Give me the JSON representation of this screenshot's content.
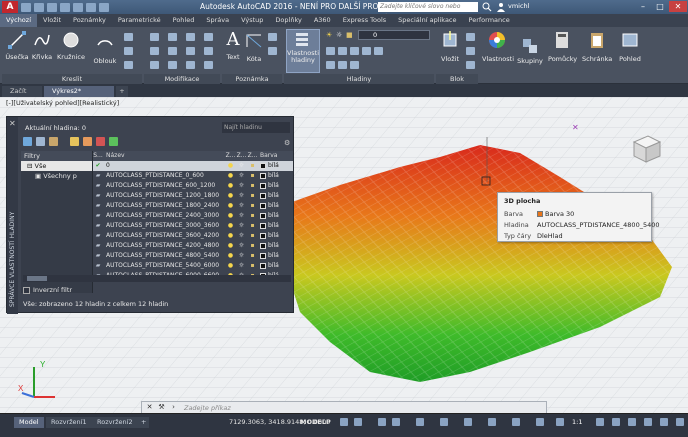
{
  "titlebar": {
    "app_letter": "A",
    "title": "Autodesk AutoCAD 2016 - NENÍ PRO DALŠÍ PRODEJ     Výkres2.dwg",
    "search_placeholder": "Zadejte klíčové slovo nebo výraz...",
    "user": "vmichl"
  },
  "ribbon_tabs": [
    "Výchozí",
    "Vložit",
    "Poznámky",
    "Parametrické",
    "Pohled",
    "Správa",
    "Výstup",
    "Doplňky",
    "A360",
    "Express Tools",
    "Speciální aplikace",
    "Performance"
  ],
  "ribbon": {
    "draw": {
      "line": "Úsečka",
      "polyline": "Křivka",
      "circle": "Kružnice",
      "arc": "Oblouk",
      "label": "Kreslit"
    },
    "modify": {
      "label": "Modifikace"
    },
    "annotation": {
      "text": "Text",
      "dimension": "Kóta",
      "label": "Poznámka"
    },
    "layers": {
      "props": "Vlastnosti\nhladiny",
      "current_value": "0",
      "label": "Hladiny"
    },
    "block": {
      "insert": "Vložit",
      "label": "Blok"
    },
    "properties": "Vlastnosti",
    "groups": "Skupiny",
    "utilities": "Pomůcky",
    "clipboard": "Schránka",
    "view": "Pohled"
  },
  "file_tabs": [
    "Začít",
    "Výkres2*",
    "+"
  ],
  "viewport": {
    "label": "[-][Uživatelský pohled][Realistický]",
    "viewcube_face": "HORNÍ"
  },
  "layers_palette": {
    "vertical_title": "SPRÁVCE VLASTNOSTÍ HLADINY",
    "current_layer": "Aktuální hladina: 0",
    "find_placeholder": "Najít hladinu",
    "filters_header": "Filtry",
    "filters": [
      "Vše",
      "Všechny p"
    ],
    "columns": {
      "s": "S...",
      "name": "Název",
      "z1": "Z...",
      "z2": "Z...",
      "z3": "Z...",
      "color": "Barva"
    },
    "rows": [
      {
        "name": "0",
        "color": "bílá",
        "current": true
      },
      {
        "name": "AUTOCLASS_PTDISTANCE_0_600",
        "color": "bílá"
      },
      {
        "name": "AUTOCLASS_PTDISTANCE_600_1200",
        "color": "bílá"
      },
      {
        "name": "AUTOCLASS_PTDISTANCE_1200_1800",
        "color": "bílá"
      },
      {
        "name": "AUTOCLASS_PTDISTANCE_1800_2400",
        "color": "bílá"
      },
      {
        "name": "AUTOCLASS_PTDISTANCE_2400_3000",
        "color": "bílá"
      },
      {
        "name": "AUTOCLASS_PTDISTANCE_3000_3600",
        "color": "bílá"
      },
      {
        "name": "AUTOCLASS_PTDISTANCE_3600_4200",
        "color": "bílá"
      },
      {
        "name": "AUTOCLASS_PTDISTANCE_4200_4800",
        "color": "bílá"
      },
      {
        "name": "AUTOCLASS_PTDISTANCE_4800_5400",
        "color": "bílá"
      },
      {
        "name": "AUTOCLASS_PTDISTANCE_5400_6000",
        "color": "bílá"
      },
      {
        "name": "AUTOCLASS_PTDISTANCE_6000_6600",
        "color": "bílá"
      }
    ],
    "invert_filter": "Inverzní filtr",
    "status": "Vše: zobrazeno 12 hladin z celkem 12 hladin"
  },
  "tooltip": {
    "title": "3D plocha",
    "color_label": "Barva",
    "color_value": "Barva 30",
    "color_hex": "#e8751a",
    "layer_label": "Hladina",
    "layer_value": "AUTOCLASS_PTDISTANCE_4800_5400",
    "linetype_label": "Typ čáry",
    "linetype_value": "DleHlad"
  },
  "command_line": {
    "placeholder": "Zadejte příkaz"
  },
  "statusbar": {
    "tabs": [
      "Model",
      "Rozvržení1",
      "Rozvržení2"
    ],
    "coords": "7129.3063, 3418.9148, 0.0000",
    "modelp": "MODELP",
    "scale": "1:1"
  }
}
